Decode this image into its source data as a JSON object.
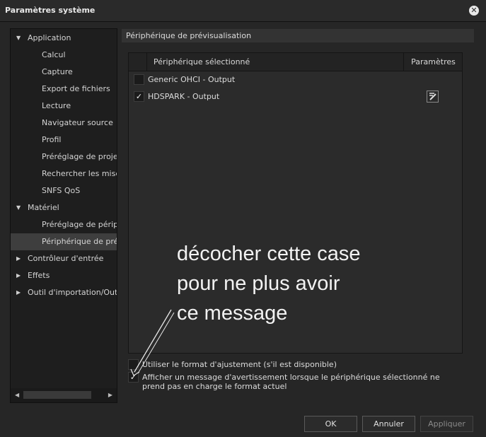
{
  "window": {
    "title": "Paramètres système"
  },
  "tree": {
    "items": [
      {
        "label": "Application",
        "level": 0,
        "arrow": "▼"
      },
      {
        "label": "Calcul",
        "level": 1
      },
      {
        "label": "Capture",
        "level": 1
      },
      {
        "label": "Export de fichiers",
        "level": 1
      },
      {
        "label": "Lecture",
        "level": 1
      },
      {
        "label": "Navigateur source",
        "level": 1
      },
      {
        "label": "Profil",
        "level": 1
      },
      {
        "label": "Préréglage de projets",
        "level": 1
      },
      {
        "label": "Rechercher les mises à",
        "level": 1
      },
      {
        "label": "SNFS QoS",
        "level": 1
      },
      {
        "label": "Matériel",
        "level": 0,
        "arrow": "▼"
      },
      {
        "label": "Préréglage de périphé",
        "level": 1
      },
      {
        "label": "Périphérique de prévis",
        "level": 1,
        "selected": true
      },
      {
        "label": "Contrôleur d'entrée",
        "level": 0,
        "arrow": "▶"
      },
      {
        "label": "Effets",
        "level": 0,
        "arrow": "▶"
      },
      {
        "label": "Outil d'importation/Outil d'",
        "level": 0,
        "arrow": "▶"
      }
    ],
    "scroll_left": "◀",
    "scroll_right": "▶"
  },
  "section": {
    "title": "Périphérique de prévisualisation"
  },
  "table": {
    "columns": {
      "device": "Périphérique sélectionné",
      "params": "Paramètres"
    },
    "rows": [
      {
        "name": "Generic OHCI - Output",
        "checked": false,
        "has_settings": false
      },
      {
        "name": "HDSPARK - Output",
        "checked": true,
        "has_settings": true
      }
    ]
  },
  "options": {
    "adjust_format": {
      "label": "Utiliser le format d'ajustement (s'il est disponible)",
      "checked": false
    },
    "warn_message": {
      "label": "Afficher un message d'avertissement lorsque le périphérique sélectionné ne prend pas en charge le format actuel",
      "checked": true
    }
  },
  "check_glyph": "✓",
  "annotation": {
    "line1": "décocher cette case",
    "line2": "pour ne plus avoir",
    "line3": "ce message"
  },
  "buttons": {
    "ok": "OK",
    "cancel": "Annuler",
    "apply": "Appliquer"
  }
}
